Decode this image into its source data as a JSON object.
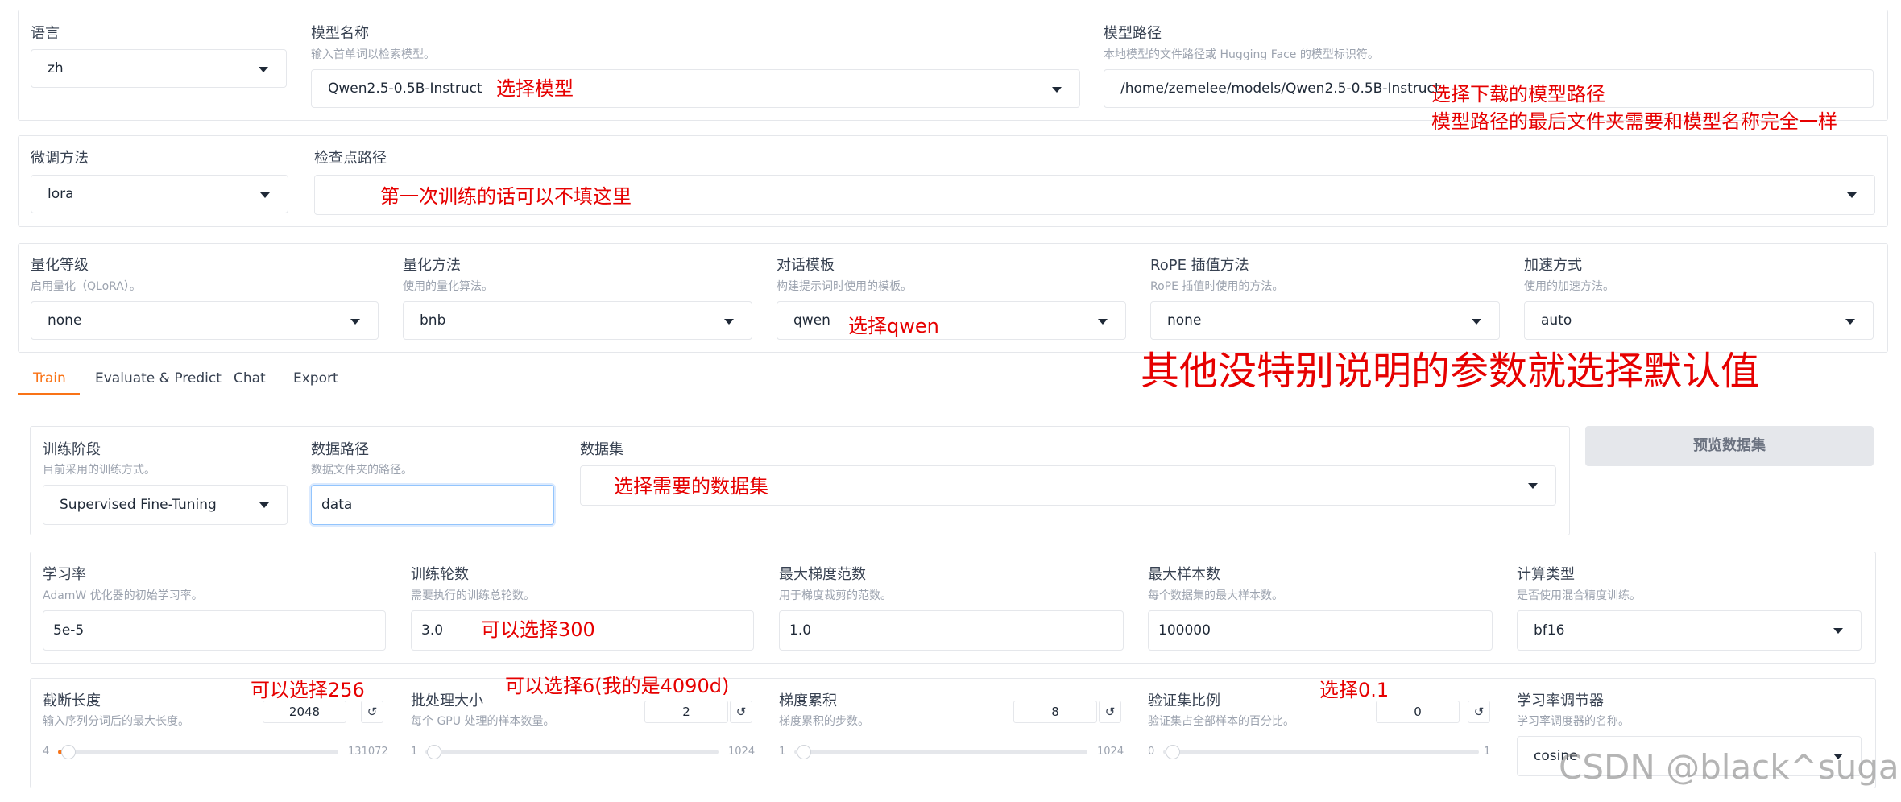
{
  "row1": {
    "lang": {
      "label": "语言",
      "value": "zh"
    },
    "model_name": {
      "label": "模型名称",
      "info": "输入首单词以检索模型。",
      "value": "Qwen2.5-0.5B-Instruct"
    },
    "model_path": {
      "label": "模型路径",
      "info": "本地模型的文件路径或 Hugging Face 的模型标识符。",
      "value": "/home/zemelee/models/Qwen2.5-0.5B-Instruct"
    }
  },
  "row2": {
    "finetune": {
      "label": "微调方法",
      "value": "lora"
    },
    "checkpoint": {
      "label": "检查点路径",
      "value": ""
    }
  },
  "row3": {
    "quant_bit": {
      "label": "量化等级",
      "info": "启用量化（QLoRA）。",
      "value": "none"
    },
    "quant_method": {
      "label": "量化方法",
      "info": "使用的量化算法。",
      "value": "bnb"
    },
    "template": {
      "label": "对话模板",
      "info": "构建提示词时使用的模板。",
      "value": "qwen"
    },
    "rope": {
      "label": "RoPE 插值方法",
      "info": "RoPE 插值时使用的方法。",
      "value": "none"
    },
    "booster": {
      "label": "加速方式",
      "info": "使用的加速方法。",
      "value": "auto"
    }
  },
  "tabs": [
    "Train",
    "Evaluate & Predict",
    "Chat",
    "Export"
  ],
  "train": {
    "stage": {
      "label": "训练阶段",
      "info": "目前采用的训练方式。",
      "value": "Supervised Fine-Tuning"
    },
    "dataset_dir": {
      "label": "数据路径",
      "info": "数据文件夹的路径。",
      "value": "data"
    },
    "dataset": {
      "label": "数据集",
      "value": ""
    },
    "preview_button": "预览数据集",
    "lr": {
      "label": "学习率",
      "info": "AdamW 优化器的初始学习率。",
      "value": "5e-5"
    },
    "epochs": {
      "label": "训练轮数",
      "info": "需要执行的训练总轮数。",
      "value": "3.0"
    },
    "max_grad_norm": {
      "label": "最大梯度范数",
      "info": "用于梯度裁剪的范数。",
      "value": "1.0"
    },
    "max_samples": {
      "label": "最大样本数",
      "info": "每个数据集的最大样本数。",
      "value": "100000"
    },
    "compute_type": {
      "label": "计算类型",
      "info": "是否使用混合精度训练。",
      "value": "bf16"
    },
    "cutoff_len": {
      "label": "截断长度",
      "info": "输入序列分词后的最大长度。",
      "value": "2048",
      "min": "4",
      "max": "131072"
    },
    "batch_size": {
      "label": "批处理大小",
      "info": "每个 GPU 处理的样本数量。",
      "value": "2",
      "min": "1",
      "max": "1024"
    },
    "grad_accum": {
      "label": "梯度累积",
      "info": "梯度累积的步数。",
      "value": "8",
      "min": "1",
      "max": "1024"
    },
    "val_size": {
      "label": "验证集比例",
      "info": "验证集占全部样本的百分比。",
      "value": "0",
      "min": "0",
      "max": "1"
    },
    "lr_scheduler": {
      "label": "学习率调节器",
      "info": "学习率调度器的名称。",
      "value": "cosine"
    }
  },
  "reset_icon": "↺",
  "annotations": {
    "select_model": "选择模型",
    "select_path": "选择下载的模型路径",
    "path_note": "模型路径的最后文件夹需要和模型名称完全一样",
    "checkpoint_note": "第一次训练的话可以不填这里",
    "select_qwen": "选择qwen",
    "default_note": "其他没特别说明的参数就选择默认值",
    "select_dataset": "选择需要的数据集",
    "epochs_note": "可以选择300",
    "cutoff_note": "可以选择256",
    "batch_note": "可以选择6(我的是4090d)",
    "val_note": "选择0.1"
  },
  "watermark": "CSDN @black^sugar",
  "colors": {
    "accent": "#f97316",
    "annotation": "#e60000",
    "border": "#e5e7eb"
  }
}
